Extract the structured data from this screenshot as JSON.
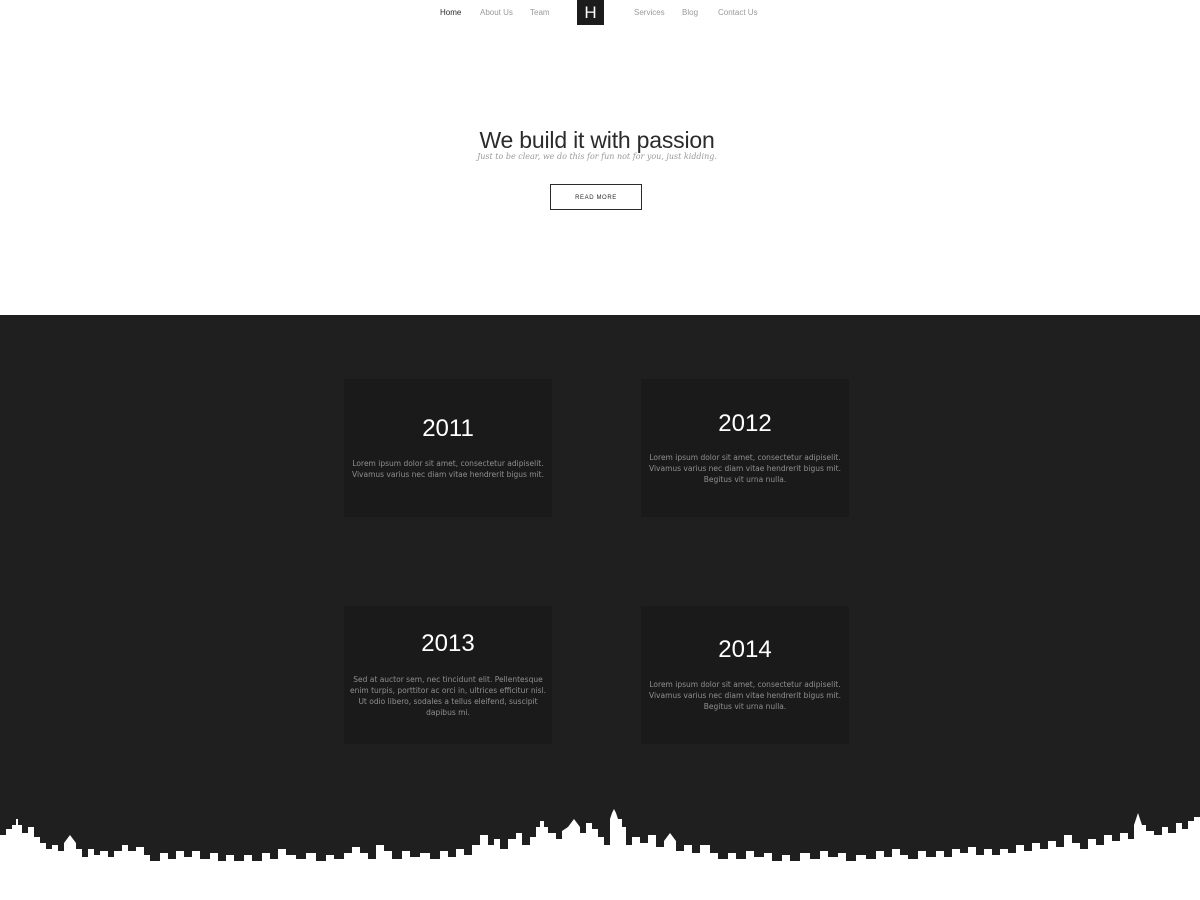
{
  "nav": {
    "items": [
      {
        "label": "Home"
      },
      {
        "label": "About Us"
      },
      {
        "label": "Team"
      },
      {
        "label": "Services"
      },
      {
        "label": "Blog"
      },
      {
        "label": "Contact Us"
      }
    ],
    "logo": "H"
  },
  "hero": {
    "title": "We build it with passion",
    "subtitle": "Just to be clear, we do this for fun not for you, just kidding.",
    "button_label": "READ MORE"
  },
  "timeline": {
    "cards": [
      {
        "year": "2011",
        "text": "Lorem ipsum dolor sit amet, consectetur adipiselit. Vivamus varius nec diam vitae hendrerit bigus mit."
      },
      {
        "year": "2012",
        "text": "Lorem ipsum dolor sit amet, consectetur adipiselit. Vivamus varius nec diam vitae hendrerit bigus mit. Begitus vit urna nulla."
      },
      {
        "year": "2013",
        "text": "Sed at auctor sem, nec tincidunt elit. Pellentesque enim turpis, porttitor ac orci in, ultrices efficitur nisl. Ut odio libero, sodales a tellus eleifend, suscipit dapibus mi."
      },
      {
        "year": "2014",
        "text": "Lorem ipsum dolor sit amet, consectetur adipiselit. Vivamus varius nec diam vitae hendrerit bigus mit. Begitus vit urna nulla."
      }
    ]
  },
  "colors": {
    "dark_background": "#1f1f1f",
    "card_background": "#1a1a1a",
    "text_dark": "#2b2b2b",
    "text_muted": "#9a9a9a"
  }
}
